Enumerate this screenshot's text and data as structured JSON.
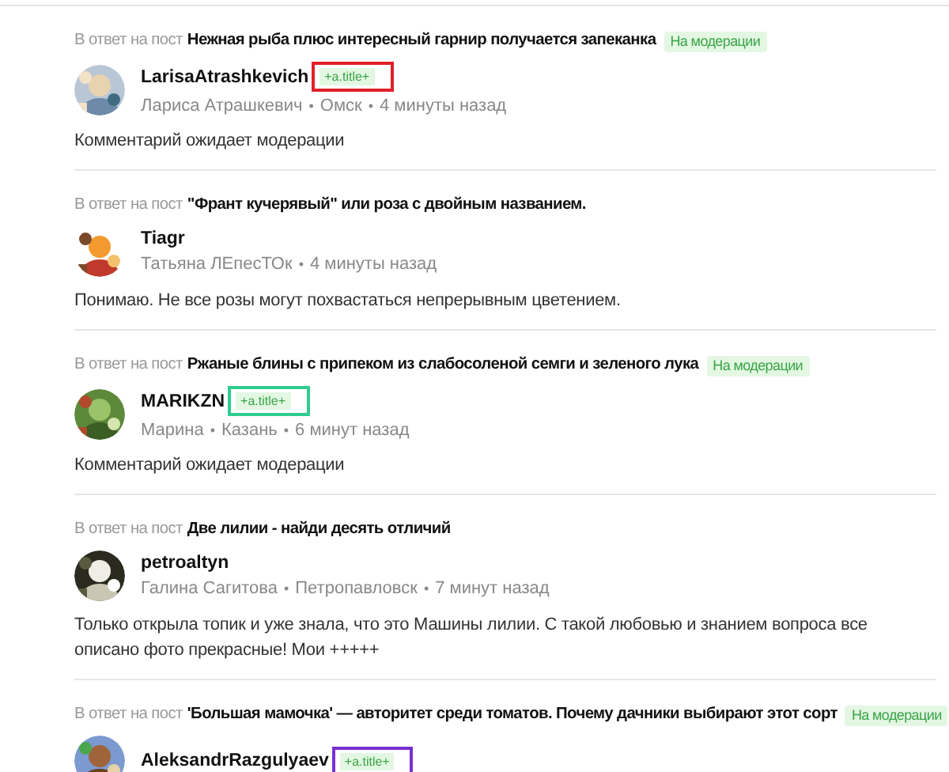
{
  "comments": [
    {
      "reply_label": "В ответ на пост",
      "post_title": "Нежная рыба плюс интересный гарнир получается запеканка",
      "moderation_label": "На модерации",
      "username": "LarisaAtrashkevich",
      "tag": {
        "text": "+a.title+",
        "color": "#e0202a"
      },
      "meta": [
        {
          "kind": "text",
          "text": "Лариса Атрашкевич"
        },
        {
          "kind": "sep",
          "text": "•"
        },
        {
          "kind": "text",
          "text": "Омск"
        },
        {
          "kind": "sep",
          "text": "•"
        },
        {
          "kind": "text",
          "text": "4 минуты назад"
        }
      ],
      "body": "Комментарий ожидает модерации"
    },
    {
      "reply_label": "В ответ на пост",
      "post_title": "\"Франт кучерявый\" или роза с двойным названием.",
      "username": "Tiagr",
      "meta": [
        {
          "kind": "text",
          "text": "Татьяна ЛЕпесТОк"
        },
        {
          "kind": "sep",
          "text": "•"
        },
        {
          "kind": "text",
          "text": "4 минуты назад"
        }
      ],
      "body": "Понимаю. Не все розы могут похвастаться непрерывным цветением."
    },
    {
      "reply_label": "В ответ на пост",
      "post_title": "Ржаные блины с припеком из слабосоленой семги и зеленого лука",
      "moderation_label": "На модерации",
      "username": "MARIKZN",
      "tag": {
        "text": "+a.title+",
        "color": "#2ecc8f"
      },
      "meta": [
        {
          "kind": "text",
          "text": "Марина"
        },
        {
          "kind": "sep",
          "text": "•"
        },
        {
          "kind": "text",
          "text": "Казань"
        },
        {
          "kind": "sep",
          "text": "•"
        },
        {
          "kind": "text",
          "text": "6 минут назад"
        }
      ],
      "body": "Комментарий ожидает модерации"
    },
    {
      "reply_label": "В ответ на пост",
      "post_title": "Две лилии - найди десять отличий",
      "username": "petroaltyn",
      "meta": [
        {
          "kind": "text",
          "text": "Галина Сагитова"
        },
        {
          "kind": "sep",
          "text": "•"
        },
        {
          "kind": "text",
          "text": "Петропавловск"
        },
        {
          "kind": "sep",
          "text": "•"
        },
        {
          "kind": "text",
          "text": "7 минут назад"
        }
      ],
      "body": "Только открыла топик и уже знала, что это Машины лилии. С такой любовью и знанием вопроса все описано фото прекрасные! Мои +++++"
    },
    {
      "reply_label": "В ответ на пост",
      "post_title": "'Большая мамочка' — авторитет среди томатов. Почему дачники выбирают этот сорт",
      "moderation_label": "На модерации",
      "username": "AleksandrRazgulyaev",
      "tag": {
        "text": "+a.title+",
        "color": "#7b2fd0"
      }
    }
  ]
}
